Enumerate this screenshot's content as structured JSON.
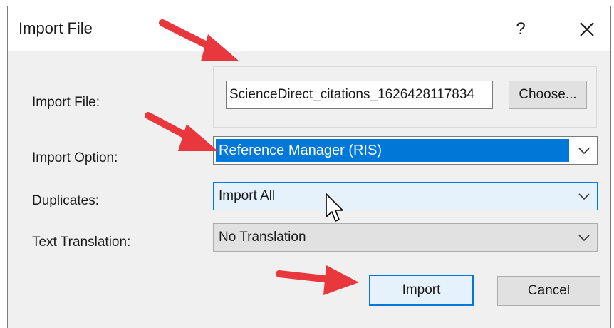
{
  "dialog": {
    "title": "Import File",
    "help_symbol": "?",
    "fields": {
      "import_file": {
        "label": "Import File:",
        "value": "ScienceDirect_citations_1626428117834",
        "choose_label": "Choose..."
      },
      "import_option": {
        "label": "Import Option:",
        "selected": "Reference Manager (RIS)"
      },
      "duplicates": {
        "label": "Duplicates:",
        "selected": "Import All"
      },
      "text_translation": {
        "label": "Text Translation:",
        "selected": "No Translation"
      }
    },
    "buttons": {
      "import_label": "Import",
      "cancel_label": "Cancel"
    }
  },
  "icons": {
    "help": "question-mark",
    "close": "x-close",
    "dropdown": "chevron-down",
    "pointer": "mouse-arrow-cursor",
    "annotation": "red-arrow"
  },
  "colors": {
    "accent_blue": "#0078d7",
    "arrow_red": "#e8383d",
    "dialog_background": "#f0f0f0",
    "titlebar_background": "#ffffff"
  }
}
